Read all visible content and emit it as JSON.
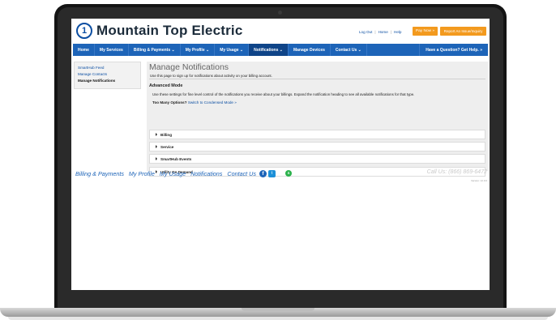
{
  "brand": {
    "logo_glyph": "1",
    "name": "Mountain Top Electric",
    "primary_color": "#1d64b8",
    "accent_color": "#f39a1e"
  },
  "header": {
    "log_out": "Log Out",
    "home": "Home",
    "help": "Help",
    "separator": "|",
    "pay_now": "Pay Now »",
    "report_outage": "Report An Issue/Inquiry"
  },
  "nav": {
    "items": [
      {
        "label": "Home"
      },
      {
        "label": "My Services"
      },
      {
        "label": "Billing & Payments ⌄"
      },
      {
        "label": "My Profile ⌄"
      },
      {
        "label": "My Usage ⌄"
      },
      {
        "label": "Notifications ⌄"
      },
      {
        "label": "Manage Devices"
      },
      {
        "label": "Contact Us ⌄"
      }
    ],
    "help": "Have a Question? Get Help. »"
  },
  "sidebar": {
    "items": [
      {
        "label": "SmartHub Feed"
      },
      {
        "label": "Manage Contacts"
      },
      {
        "label": "Manage Notifications"
      }
    ]
  },
  "main": {
    "title": "Manage Notifications",
    "subtitle": "Use this page to sign up for notifications about activity on your billing account.",
    "mode_heading": "Advanced Mode",
    "description": "Use these settings for fine level control of the notifications you receive about your billings. Expand the notification heading to see all available notifications for that type.",
    "too_many_label": "Too Many Options?",
    "switch_link": "Switch to Condensed Mode »",
    "sections": [
      {
        "label": "Billing"
      },
      {
        "label": "Service"
      },
      {
        "label": "SmartHub Events"
      },
      {
        "label": "Utility On Demand"
      }
    ]
  },
  "footer": {
    "links": [
      {
        "label": "Billing & Payments"
      },
      {
        "label": "My Profile"
      },
      {
        "label": "My Usage"
      },
      {
        "label": "Notifications"
      },
      {
        "label": "Contact Us"
      }
    ],
    "facebook_glyph": "f",
    "twitter_glyph": "t",
    "app_glyph": "a",
    "call_us": "Call Us: (866) 869-6472",
    "version": "Version: 12.0.0"
  }
}
